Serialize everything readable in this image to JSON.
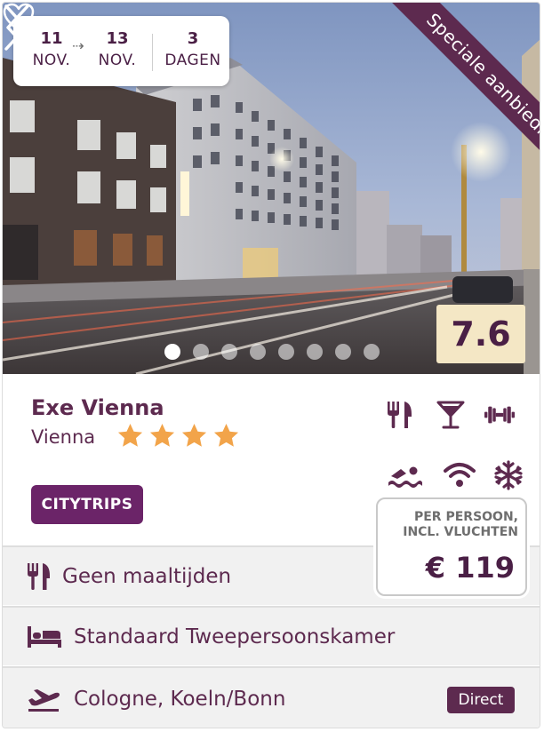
{
  "dates": {
    "from_day": "11",
    "from_month": "NOV.",
    "to_day": "13",
    "to_month": "NOV.",
    "duration_number": "3",
    "duration_unit": "DAGEN"
  },
  "ribbon": "Speciale aanbieding",
  "score": "7.6",
  "gallery": {
    "slide_count": 8,
    "active_slide": 1
  },
  "hotel": {
    "name": "Exe Vienna",
    "city": "Vienna",
    "stars": 4
  },
  "badge": "CITYTRIPS",
  "facilities": [
    "restaurant-icon",
    "bar-icon",
    "fitness-icon",
    "swimming-icon",
    "wifi-icon",
    "aircon-icon"
  ],
  "price": {
    "label_line1": "PER PERSOON,",
    "label_line2": "INCL. VLUCHTEN",
    "amount": "€ 119"
  },
  "details": {
    "meals": "Geen maaltijden",
    "room": "Standaard Tweepersoonskamer",
    "flight": "Cologne, Koeln/Bonn",
    "flight_tag": "Direct"
  },
  "colors": {
    "brand": "#5d2a4f",
    "badge": "#6b2468",
    "score_bg": "#f4e7c5",
    "star": "#f2a44a"
  }
}
